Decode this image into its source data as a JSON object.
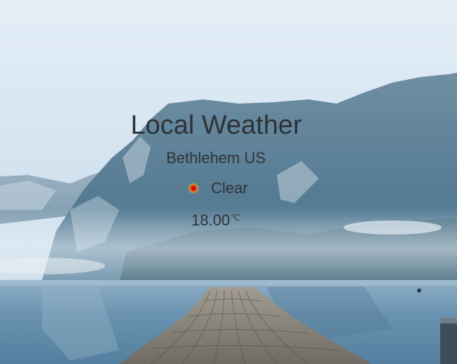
{
  "weather": {
    "title": "Local Weather",
    "location": "Bethlehem US",
    "condition": "Clear",
    "condition_icon": "clear-sun-icon",
    "temperature": "18.00",
    "unit": "℃"
  },
  "colors": {
    "text": "#2f3338",
    "sky_top": "#dde9f4",
    "mountain": "#5b7f97",
    "water": "#5f88a8",
    "dock": "#8f8a82"
  }
}
